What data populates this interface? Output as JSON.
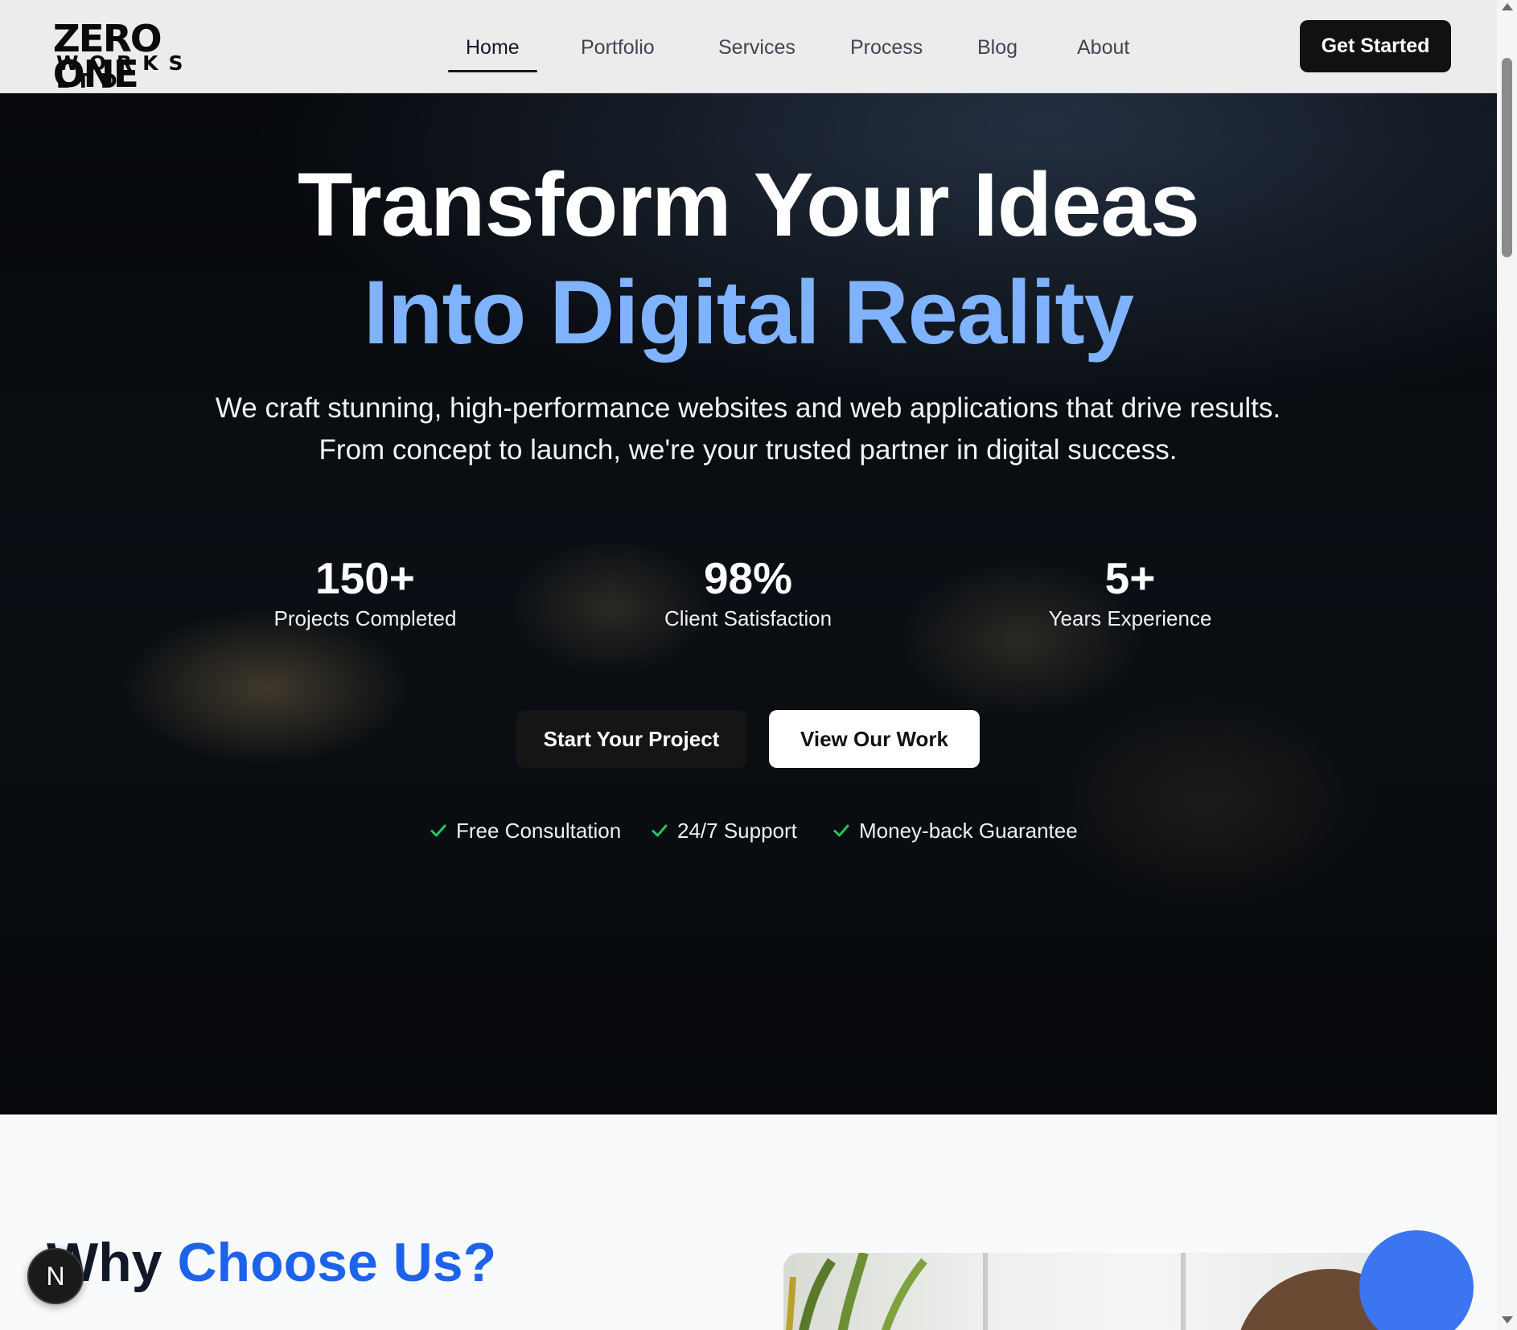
{
  "brand": {
    "logo_line1": "ZERO ONE",
    "logo_line2": "WORKS LTD"
  },
  "nav": {
    "items": [
      {
        "label": "Home",
        "active": true
      },
      {
        "label": "Portfolio"
      },
      {
        "label": "Services"
      },
      {
        "label": "Process"
      },
      {
        "label": "Blog"
      },
      {
        "label": "About"
      }
    ],
    "cta_label": "Get Started"
  },
  "hero": {
    "title_line1": "Transform Your Ideas",
    "title_line2": "Into Digital Reality",
    "subtitle_line1": "We craft stunning, high-performance websites and web applications that drive results.",
    "subtitle_line2": "From concept to launch, we're your trusted partner in digital success.",
    "stats": [
      {
        "value": "150+",
        "label": "Projects Completed"
      },
      {
        "value": "98%",
        "label": "Client Satisfaction"
      },
      {
        "value": "5+",
        "label": "Years Experience"
      }
    ],
    "primary_button": "Start Your Project",
    "secondary_button": "View Our Work",
    "perks": [
      "Free Consultation",
      "24/7 Support",
      "Money-back Guarantee"
    ]
  },
  "why": {
    "title_plain": "Why ",
    "title_accent": "Choose Us?"
  },
  "dev_badge": {
    "letter": "N"
  },
  "colors": {
    "accent_blue": "#1d63ea",
    "hero_title_blue": "#7fb2ff",
    "check_green": "#22c55e",
    "header_bg": "#ececec",
    "hero_bg": "#07090c"
  },
  "icons": {
    "perk_icon": "check-icon",
    "scroll_up": "chevron-up-icon",
    "scroll_down": "chevron-down-icon"
  }
}
